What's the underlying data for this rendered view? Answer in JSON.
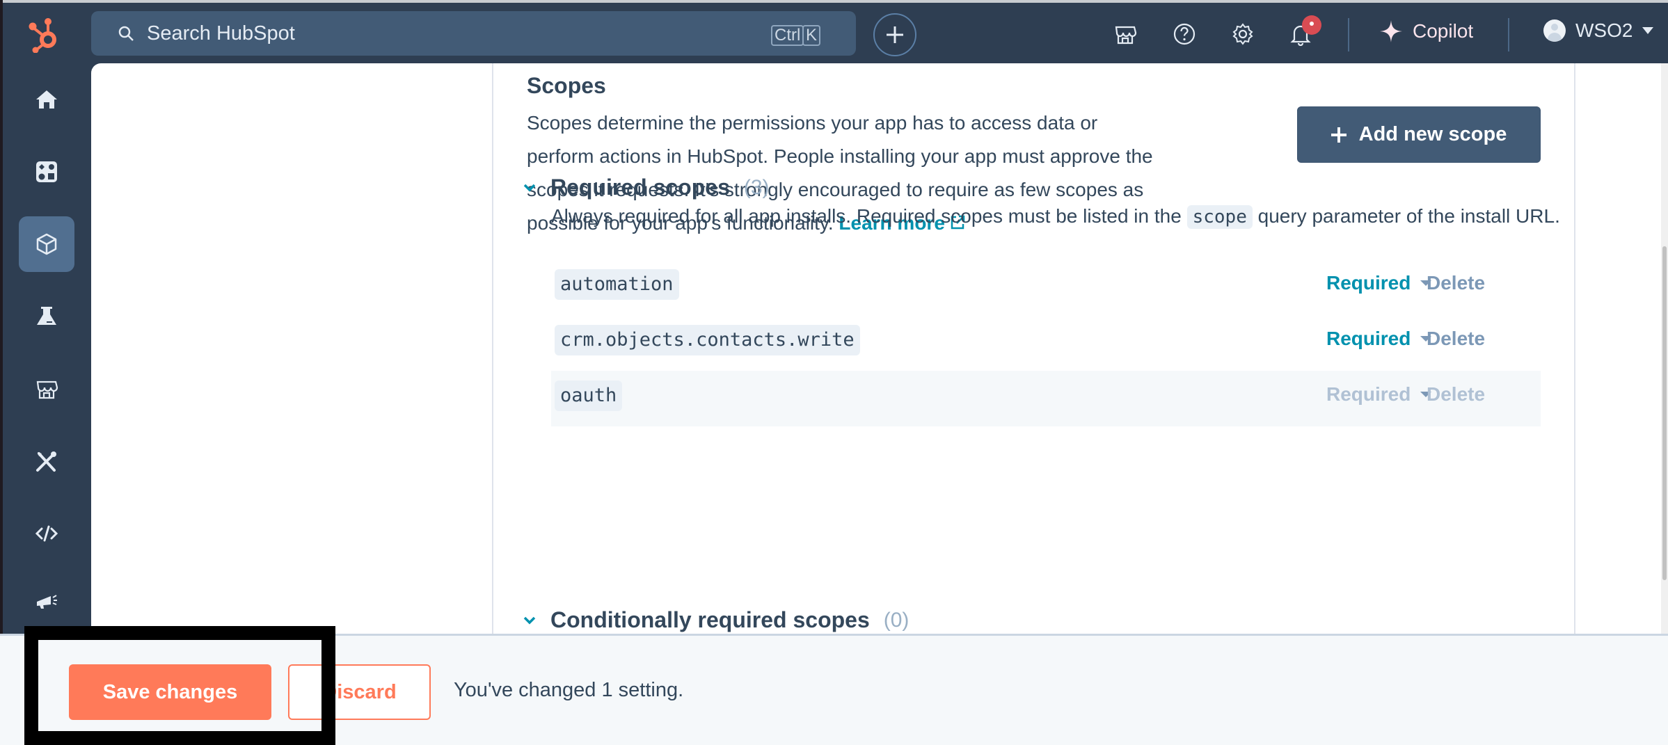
{
  "topbar": {
    "logo": "hubspot-logo",
    "search": {
      "placeholder": "Search HubSpot",
      "shortcut_keys": [
        "Ctrl",
        "K"
      ]
    },
    "create_button_icon": "plus-icon",
    "icons": [
      "marketplace-icon",
      "help-icon",
      "settings-icon",
      "notifications-icon"
    ],
    "notification_badge": true,
    "copilot_label": "Copilot",
    "account_label": "WSO2"
  },
  "sidebar": {
    "items": [
      {
        "icon": "home-icon",
        "active": false
      },
      {
        "icon": "workspaces-icon",
        "active": false
      },
      {
        "icon": "apps-cube-icon",
        "active": true
      },
      {
        "icon": "test-accounts-flask-icon",
        "active": false
      },
      {
        "icon": "marketplace-icon",
        "active": false
      },
      {
        "icon": "tools-icon",
        "active": false
      },
      {
        "icon": "code-icon",
        "active": false
      },
      {
        "icon": "marketing-megaphone-icon",
        "active": false
      }
    ]
  },
  "scopes": {
    "title": "Scopes",
    "description": "Scopes determine the permissions your app has to access data or perform actions in HubSpot. People installing your app must approve the scopes it requests. It's strongly encouraged to require as few scopes as possible for your app's functionality.",
    "learn_more": "Learn more",
    "add_button": "Add new scope",
    "required": {
      "title": "Required scopes",
      "count": "(3)",
      "description_before": "Always required for all app installs. Required scopes must be listed in the",
      "description_code": "scope",
      "description_after": "query parameter of the install URL.",
      "rows": [
        {
          "scope": "automation",
          "level": "Required",
          "action": "Delete",
          "disabled": false
        },
        {
          "scope": "crm.objects.contacts.write",
          "level": "Required",
          "action": "Delete",
          "disabled": false
        },
        {
          "scope": "oauth",
          "level": "Required",
          "action": "Delete",
          "disabled": true
        }
      ]
    },
    "conditional": {
      "title": "Conditionally required scopes",
      "count": "(0)"
    }
  },
  "footer": {
    "save_label": "Save changes",
    "discard_label": "Discard",
    "message": "You've changed 1 setting."
  },
  "colors": {
    "nav_bg": "#2e3e52",
    "accent_orange": "#ff7a59",
    "link_teal": "#0091ae",
    "button_slate": "#425b76"
  }
}
